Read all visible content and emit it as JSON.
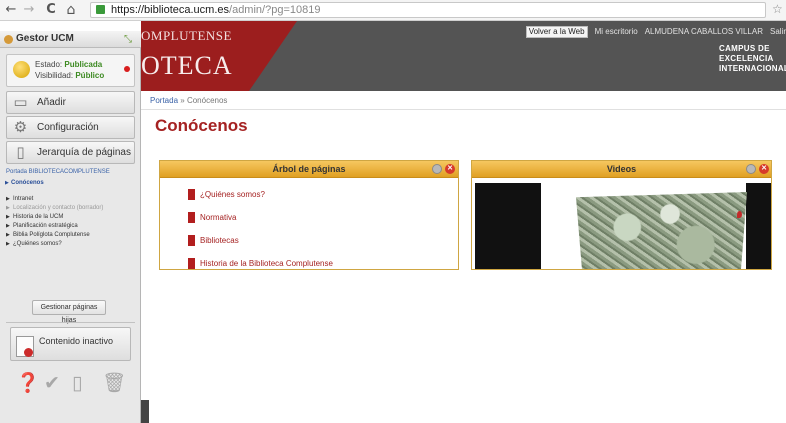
{
  "browser": {
    "back": "←",
    "forward": "→",
    "reload": "C",
    "home": "⌂",
    "url_host": "https://biblioteca.ucm.es",
    "url_rest": "/admin/?pg=10819",
    "star": "☆"
  },
  "admin_panel": {
    "title": "Gestor UCM",
    "status_label": "Estado:",
    "status_value": "Publicada",
    "visibility_label": "Visibilidad:",
    "visibility_value": "Público",
    "menu": [
      {
        "label": "Añadir",
        "icon": "add-page-icon"
      },
      {
        "label": "Configuración",
        "icon": "gear-icon"
      },
      {
        "label": "Jerarquía de páginas",
        "icon": "page-tree-icon"
      }
    ],
    "page_tree": {
      "root": "Portada BIBLIOTECACOMPLUTENSE",
      "current": "Conócenos",
      "items": [
        {
          "label": "Intranet",
          "dim": false
        },
        {
          "label": "Localización y contacto (borrador)",
          "dim": true
        },
        {
          "label": "Historia de la UCM",
          "dim": false
        },
        {
          "label": "Planificación estratégica",
          "dim": false
        },
        {
          "label": "Biblia Políglota Complutense",
          "dim": false
        },
        {
          "label": "¿Quiénes somos?",
          "dim": false
        }
      ]
    },
    "manage_button": "Gestionar páginas hijas",
    "inactive_button": "Contenido inactivo",
    "tools": [
      "help-icon",
      "check-icon",
      "new-page-icon",
      "trash-icon"
    ]
  },
  "site_header": {
    "brand_top": "OMPLUTENSE",
    "brand_big": "OTECA",
    "links": [
      "Volver a la Web",
      "Mi escritorio",
      "ALMUDENA CABALLOS VILLAR",
      "Salir"
    ],
    "campus_lines": [
      "CAMPUS DE",
      "EXCELENCIA",
      "INTERNACIONAL"
    ]
  },
  "breadcrumb": {
    "home": "Portada",
    "separator": "»",
    "current": "Conócenos"
  },
  "page_title": "Conócenos",
  "widgets": {
    "tree": {
      "title": "Árbol de páginas",
      "items": [
        "¿Quiénes somos?",
        "Normativa",
        "Bibliotecas",
        "Historia de la Biblioteca Complutense"
      ]
    },
    "videos": {
      "title": "Videos"
    }
  },
  "colors": {
    "accent_red": "#a52222",
    "header_gray": "#545454",
    "widget_header": "#e0a023",
    "status_green": "#3d8a22"
  }
}
